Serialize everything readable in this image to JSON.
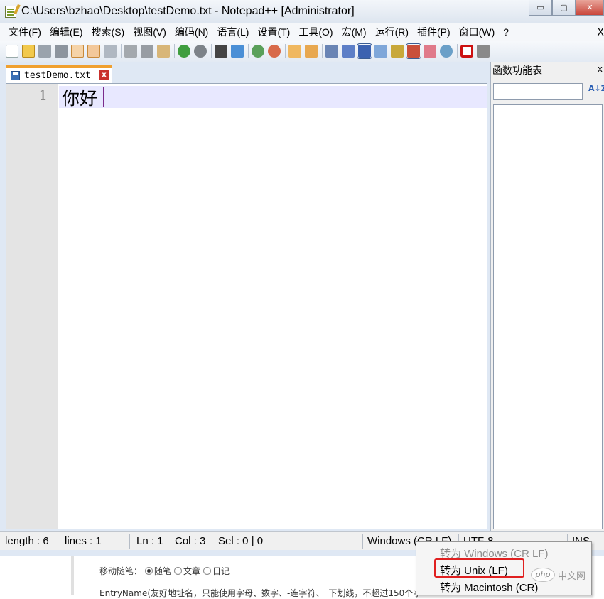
{
  "window": {
    "title": "C:\\Users\\bzhao\\Desktop\\testDemo.txt - Notepad++ [Administrator]",
    "controls": {
      "minimize": "▭",
      "maximize": "▢",
      "close": "✕"
    }
  },
  "menubar": {
    "items": [
      "文件(F)",
      "编辑(E)",
      "搜索(S)",
      "视图(V)",
      "编码(N)",
      "语言(L)",
      "设置(T)",
      "工具(O)",
      "宏(M)",
      "运行(R)",
      "插件(P)",
      "窗口(W)",
      "?"
    ],
    "close_x": "X"
  },
  "toolbar": {
    "icons": [
      "new-file-icon",
      "open-file-icon",
      "save-icon",
      "save-all-icon",
      "close-icon",
      "close-all-icon",
      "print-icon",
      "cut-icon",
      "copy-icon",
      "paste-icon",
      "undo-icon",
      "redo-icon",
      "find-icon",
      "replace-icon",
      "zoom-in-icon",
      "zoom-out-icon",
      "sync-vertical-icon",
      "sync-horizontal-icon",
      "word-wrap-icon",
      "show-all-chars-icon",
      "indent-guide-icon",
      "doc-map-icon",
      "function-list-icon",
      "folder-workspace-icon",
      "monitoring-icon",
      "record-macro-icon",
      "stop-macro-icon"
    ]
  },
  "tab": {
    "label": "testDemo.txt",
    "close": "x"
  },
  "editor": {
    "line_number": "1",
    "line_text": "你好"
  },
  "function_panel": {
    "title": "函数功能表",
    "close": "x",
    "search_value": "",
    "sort_icon_text": "A↓Z"
  },
  "statusbar": {
    "length": "length : 6",
    "lines": "lines : 1",
    "ln": "Ln : 1",
    "col": "Col : 3",
    "sel": "Sel : 0 | 0",
    "eol": "Windows (CR LF)",
    "encoding": "UTF-8",
    "mode": "INS"
  },
  "context_menu": {
    "items": [
      {
        "label": "转为 Windows (CR LF)",
        "disabled": true
      },
      {
        "label": "转为 Unix (LF)",
        "disabled": false
      },
      {
        "label": "转为 Macintosh (CR)",
        "disabled": false
      }
    ]
  },
  "background_page": {
    "mobile_label": "移动随笔：",
    "radio_options": [
      "随笔",
      "文章",
      "日记"
    ],
    "entry_text": "EntryName(友好地址名，只能使用字母、数字、-连字符、_下划线，不超过150个字"
  },
  "watermark": {
    "logo": "php",
    "text": "中文网"
  },
  "colors": {
    "highlight_border": "#e02020",
    "current_line": "#e8e8ff",
    "tab_accent": "#f0a030",
    "gutter": "#e4e4e4"
  }
}
